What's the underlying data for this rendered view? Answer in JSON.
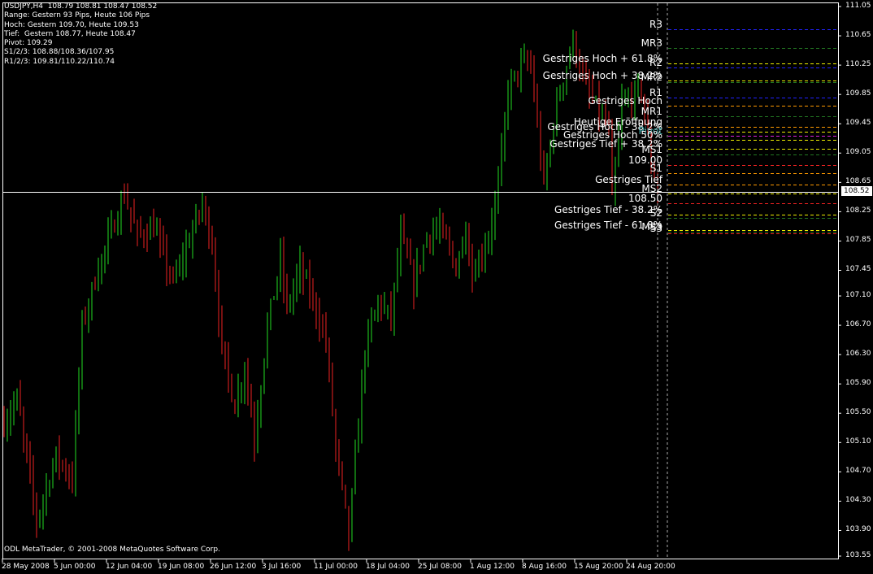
{
  "info": {
    "line1": "USDJPY,H4  108.79 108.81 108.47 108.52",
    "line2": "Range: Gestern 93 Pips, Heute 106 Pips",
    "line3": "Hoch: Gestern 109.70, Heute 109.53",
    "line4": "Tief:  Gestern 108.77, Heute 108.47",
    "line5": "Pivot: 109.29",
    "line6": "S1/2/3: 108.88/108.36/107.95",
    "line7": "R1/2/3: 109.81/110.22/110.74"
  },
  "copyright": "ODL MetaTrader, © 2001-2008 MetaQuotes Software Corp.",
  "current_price": "108.52",
  "colors": {
    "up": "#22dd22",
    "down": "#ee2222",
    "axis": "#ffffff"
  },
  "price_axis": [
    "111.05",
    "110.65",
    "110.25",
    "109.85",
    "109.45",
    "109.05",
    "108.65",
    "108.25",
    "107.85",
    "107.45",
    "107.10",
    "106.70",
    "106.30",
    "105.90",
    "105.50",
    "105.10",
    "104.70",
    "104.30",
    "103.90",
    "103.55"
  ],
  "time_axis": [
    "28 May 2008",
    "5 Jun 00:00",
    "12 Jun 04:00",
    "19 Jun 08:00",
    "26 Jun 12:00",
    "3 Jul 16:00",
    "11 Jul 00:00",
    "18 Jul 04:00",
    "25 Jul 08:00",
    "1 Aug 12:00",
    "8 Aug 16:00",
    "15 Aug 20:00",
    "24 Aug 20:00"
  ],
  "levels": [
    {
      "label": "R3",
      "price": 110.74,
      "color": "#2222ff"
    },
    {
      "label": "MR3",
      "price": 110.48,
      "color": "#227722"
    },
    {
      "label": "Gestriges Hoch + 61.8%",
      "price": 110.27,
      "color": "#eeee00"
    },
    {
      "label": "R2",
      "price": 110.22,
      "color": "#2222ff"
    },
    {
      "label": "Gestriges Hoch + 38.2%",
      "price": 110.04,
      "color": "#eeee00"
    },
    {
      "label": "MR2",
      "price": 110.02,
      "color": "#227722"
    },
    {
      "label": "R1",
      "price": 109.81,
      "color": "#2222ff"
    },
    {
      "label": "Gestriges Hoch",
      "price": 109.7,
      "color": "#ff9900"
    },
    {
      "label": "MR1",
      "price": 109.55,
      "color": "#227722"
    },
    {
      "label": "Heutige Eröffnung",
      "price": 109.41,
      "color": "#ff9900"
    },
    {
      "label": "Gestriges Hoch - 38.2%",
      "price": 109.34,
      "color": "#eeee00"
    },
    {
      "label": "Pivot",
      "price": 109.29,
      "color": "#dd22dd",
      "text_color": "#44aaaa"
    },
    {
      "label": "Gestriges Hoch 50%",
      "price": 109.23,
      "color": "#eeee00"
    },
    {
      "label": "Gestriges Tief + 38.2%",
      "price": 109.11,
      "color": "#eeee00"
    },
    {
      "label": "MS1",
      "price": 109.03,
      "color": "#227722"
    },
    {
      "label": "109.00",
      "price": 108.89,
      "color": "#ee2222"
    },
    {
      "label": "S1",
      "price": 108.78,
      "color": "#ff9900"
    },
    {
      "label": "Gestriges Tief",
      "price": 108.62,
      "color": "#ff9900"
    },
    {
      "label": "MS2",
      "price": 108.5,
      "color": "#eeee00"
    },
    {
      "label": "108.50",
      "price": 108.37,
      "color": "#ee2222"
    },
    {
      "label": "Gestriges Tief - 38.2%",
      "price": 108.21,
      "color": "#eeee00"
    },
    {
      "label": "S2",
      "price": 108.17,
      "color": "#227722"
    },
    {
      "label": "Gestriges Tief - 61.8%",
      "price": 108.0,
      "color": "#eeee00"
    },
    {
      "label": "MS3",
      "price": 107.98,
      "color": "#227722"
    },
    {
      "label": "S3",
      "price": 107.95,
      "color": "#ee2222"
    }
  ],
  "chart_data": {
    "type": "ohlc",
    "symbol": "USDJPY,H4",
    "ylim": [
      103.55,
      111.05
    ],
    "waypoints": [
      [
        0,
        105.37
      ],
      [
        4,
        105.7
      ],
      [
        10,
        104.04
      ],
      [
        16,
        104.93
      ],
      [
        21,
        104.59
      ],
      [
        24,
        106.7
      ],
      [
        29,
        107.48
      ],
      [
        37,
        108.48
      ],
      [
        41,
        107.92
      ],
      [
        46,
        108.03
      ],
      [
        52,
        107.26
      ],
      [
        61,
        108.37
      ],
      [
        64,
        107.81
      ],
      [
        67,
        106.37
      ],
      [
        71,
        105.59
      ],
      [
        74,
        106.15
      ],
      [
        77,
        105.15
      ],
      [
        81,
        106.7
      ],
      [
        85,
        107.59
      ],
      [
        87,
        106.92
      ],
      [
        91,
        107.48
      ],
      [
        96,
        106.92
      ],
      [
        99,
        106.48
      ],
      [
        102,
        105.04
      ],
      [
        106,
        103.82
      ],
      [
        109,
        105.37
      ],
      [
        111,
        106.37
      ],
      [
        115,
        107.03
      ],
      [
        119,
        106.81
      ],
      [
        122,
        107.92
      ],
      [
        126,
        107.26
      ],
      [
        130,
        107.92
      ],
      [
        134,
        108.03
      ],
      [
        139,
        107.48
      ],
      [
        142,
        108.03
      ],
      [
        144,
        107.37
      ],
      [
        149,
        107.92
      ],
      [
        152,
        108.59
      ],
      [
        155,
        109.92
      ],
      [
        159,
        110.25
      ],
      [
        162,
        110.25
      ],
      [
        166,
        108.59
      ],
      [
        169,
        109.47
      ],
      [
        171,
        109.92
      ],
      [
        175,
        110.58
      ],
      [
        179,
        109.92
      ],
      [
        182,
        109.7
      ],
      [
        186,
        109.36
      ],
      [
        187,
        108.37
      ],
      [
        190,
        109.7
      ],
      [
        196,
        109.92
      ],
      [
        199,
        108.92
      ],
      [
        201,
        108.52
      ]
    ]
  }
}
